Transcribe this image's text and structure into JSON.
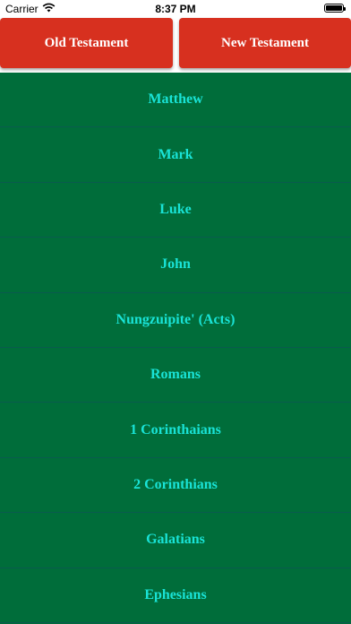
{
  "status_bar": {
    "carrier": "Carrier",
    "time": "8:37 PM",
    "icons": [
      "wifi-icon",
      "battery-icon"
    ]
  },
  "tabs": [
    {
      "label": "Old Testament"
    },
    {
      "label": "New Testament"
    }
  ],
  "books": [
    {
      "name": "Matthew"
    },
    {
      "name": "Mark"
    },
    {
      "name": "Luke"
    },
    {
      "name": "John"
    },
    {
      "name": "Nungzuipite' (Acts)"
    },
    {
      "name": "Romans"
    },
    {
      "name": "1 Corinthaians"
    },
    {
      "name": "2 Corinthians"
    },
    {
      "name": "Galatians"
    },
    {
      "name": "Ephesians"
    }
  ],
  "colors": {
    "tab_background": "#d7301f",
    "tab_text": "#ffffff",
    "list_background": "#006d3a",
    "list_text": "#19e3d6"
  }
}
